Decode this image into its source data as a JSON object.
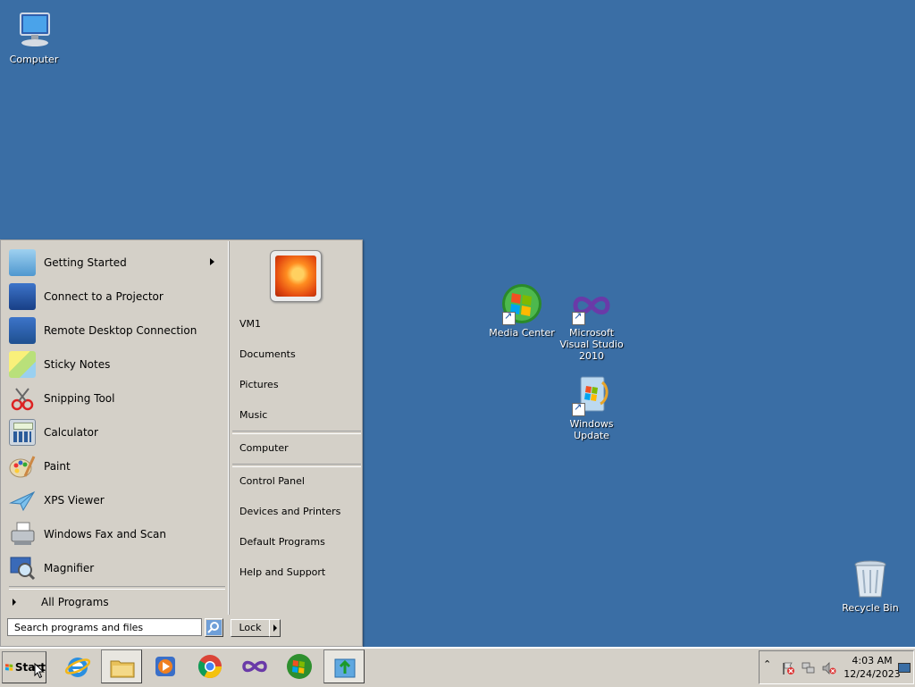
{
  "desktop": {
    "icons": [
      {
        "label": "Computer",
        "icon": "computer-icon"
      },
      {
        "label": "Media Center",
        "icon": "media-center-icon"
      },
      {
        "label": "Microsoft Visual Studio 2010",
        "icon": "visual-studio-icon"
      },
      {
        "label": "Windows Update",
        "icon": "windows-update-icon"
      },
      {
        "label": "Recycle Bin",
        "icon": "recycle-bin-icon"
      }
    ]
  },
  "start_menu": {
    "programs": [
      {
        "label": "Getting Started",
        "icon": "getting-started-icon",
        "has_submenu": true
      },
      {
        "label": "Connect to a Projector",
        "icon": "projector-icon"
      },
      {
        "label": "Remote Desktop Connection",
        "icon": "remote-desktop-icon"
      },
      {
        "label": "Sticky Notes",
        "icon": "sticky-notes-icon"
      },
      {
        "label": "Snipping Tool",
        "icon": "snipping-tool-icon"
      },
      {
        "label": "Calculator",
        "icon": "calculator-icon"
      },
      {
        "label": "Paint",
        "icon": "paint-icon"
      },
      {
        "label": "XPS Viewer",
        "icon": "xps-viewer-icon"
      },
      {
        "label": "Windows Fax and Scan",
        "icon": "fax-scan-icon"
      },
      {
        "label": "Magnifier",
        "icon": "magnifier-icon"
      }
    ],
    "all_programs": "All Programs",
    "search_placeholder": "Search programs and files",
    "right_items": [
      "VM1",
      "Documents",
      "Pictures",
      "Music",
      "Computer",
      "Control Panel",
      "Devices and Printers",
      "Default Programs",
      "Help and Support"
    ],
    "shutdown_label": "Lock"
  },
  "taskbar": {
    "start_label": "Start",
    "pinned": [
      "internet-explorer-icon",
      "windows-explorer-icon",
      "media-player-icon",
      "chrome-icon",
      "visual-studio-icon",
      "media-center-icon",
      "upload-app-icon"
    ],
    "clock_time": "4:03 AM",
    "clock_date": "12/24/2023"
  }
}
